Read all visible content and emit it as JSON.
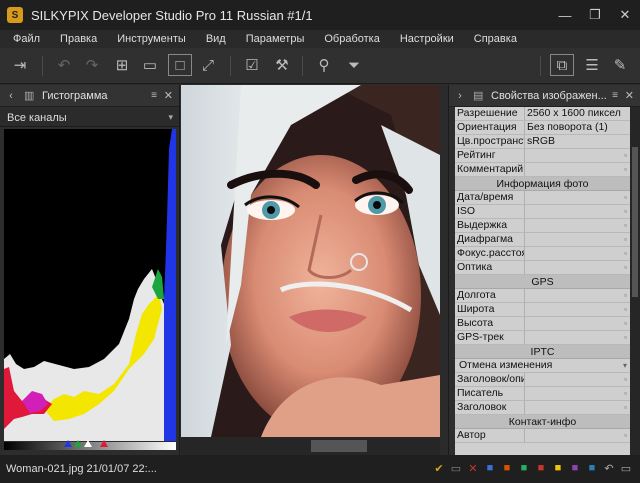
{
  "window": {
    "title": "SILKYPIX Developer Studio Pro 11 Russian   #1/1",
    "app_icon": "S",
    "minimize_icon": "—",
    "maximize_icon": "❐",
    "close_icon": "✕"
  },
  "menu": [
    "Файл",
    "Правка",
    "Инструменты",
    "Вид",
    "Параметры",
    "Обработка",
    "Настройки",
    "Справка"
  ],
  "toolbar": {
    "icons": {
      "export": "⇥",
      "undo": "↶",
      "redo": "↷",
      "grid": "⊞",
      "split": "▭",
      "single": "□",
      "fullscreen": "⤢",
      "check": "☑",
      "hammer": "⚒",
      "loupe": "⚲",
      "filter": "⏷",
      "layout": "⧉",
      "sliders": "☰",
      "pen": "✎"
    }
  },
  "histogram_panel": {
    "collapse_icon": "‹",
    "icon": "▥",
    "title": "Гистограмма",
    "menu_icon": "≡",
    "close_icon": "✕",
    "channel": "Все каналы",
    "dropdown_icon": "▾"
  },
  "properties_panel": {
    "collapse_icon": "›",
    "icon": "▤",
    "title": "Свойства изображен...",
    "menu_icon": "≡",
    "close_icon": "✕",
    "rows_main": [
      {
        "k": "Разрешение",
        "v": "2560 x 1600 пиксел"
      },
      {
        "k": "Ориентация",
        "v": "Без поворота (1)"
      },
      {
        "k": "Цв.пространство",
        "v": "sRGB"
      },
      {
        "k": "Рейтинг",
        "v": ""
      },
      {
        "k": "Комментарий",
        "v": ""
      }
    ],
    "section_photo": "Информация фото",
    "rows_photo": [
      {
        "k": "Дата/время",
        "v": ""
      },
      {
        "k": "ISO",
        "v": ""
      },
      {
        "k": "Выдержка",
        "v": ""
      },
      {
        "k": "Диафрагма",
        "v": ""
      },
      {
        "k": "Фокус.расстояние",
        "v": ""
      },
      {
        "k": "Оптика",
        "v": ""
      }
    ],
    "section_gps": "GPS",
    "rows_gps": [
      {
        "k": "Долгота",
        "v": ""
      },
      {
        "k": "Широта",
        "v": ""
      },
      {
        "k": "Высота",
        "v": ""
      },
      {
        "k": "GPS-трек",
        "v": ""
      }
    ],
    "section_iptc": "IPTC",
    "iptc_undo": "Отмена изменения",
    "rows_iptc": [
      {
        "k": "Заголовок/описание",
        "v": ""
      },
      {
        "k": "Писатель",
        "v": ""
      },
      {
        "k": "Заголовок",
        "v": ""
      }
    ],
    "section_contact": "Контакт-инфо",
    "rows_contact": [
      {
        "k": "Автор",
        "v": ""
      }
    ]
  },
  "status": {
    "text": "Woman-021.jpg 21/01/07 22:...",
    "icons": [
      "✔",
      "▭",
      "✕",
      "■",
      "■",
      "■",
      "■",
      "■",
      "■",
      "■",
      "↶",
      "▭"
    ]
  },
  "colors": {
    "accent": "#d79a1a",
    "histogram_blue": "#1f35e6",
    "histogram_yellow": "#f3e600",
    "histogram_red": "#e0193a",
    "histogram_magenta": "#d21fb8",
    "histogram_green": "#1ca640"
  }
}
